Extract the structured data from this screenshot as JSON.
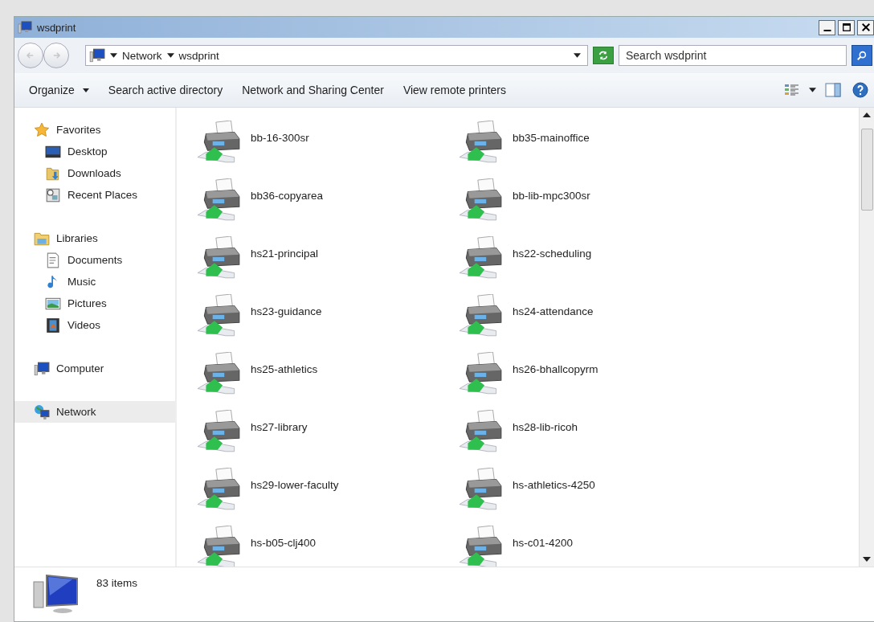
{
  "window": {
    "title": "wsdprint"
  },
  "address_bar": {
    "breadcrumbs": [
      "Network",
      "wsdprint"
    ]
  },
  "search": {
    "placeholder": "Search wsdprint"
  },
  "toolbar": [
    {
      "label": "Organize",
      "kind": "menu"
    },
    {
      "label": "Search active directory",
      "kind": "command"
    },
    {
      "label": "Network and Sharing Center",
      "kind": "command"
    },
    {
      "label": "View remote printers",
      "kind": "command"
    }
  ],
  "navigation": [
    {
      "label": "Favorites",
      "selected": false,
      "children": [
        {
          "label": "Desktop",
          "selected": false
        },
        {
          "label": "Downloads",
          "selected": false
        },
        {
          "label": "Recent Places",
          "selected": false
        }
      ]
    },
    {
      "label": "Libraries",
      "selected": false,
      "children": [
        {
          "label": "Documents",
          "selected": false
        },
        {
          "label": "Music",
          "selected": false
        },
        {
          "label": "Pictures",
          "selected": false
        },
        {
          "label": "Videos",
          "selected": false
        }
      ]
    },
    {
      "label": "Computer",
      "selected": false
    },
    {
      "label": "Network",
      "selected": true
    }
  ],
  "items": [
    {
      "name": "bb-16-300sr"
    },
    {
      "name": "bb35-mainoffice"
    },
    {
      "name": "bb36-copyarea"
    },
    {
      "name": "bb-lib-mpc300sr"
    },
    {
      "name": "hs21-principal"
    },
    {
      "name": "hs22-scheduling"
    },
    {
      "name": "hs23-guidance"
    },
    {
      "name": "hs24-attendance"
    },
    {
      "name": "hs25-athletics"
    },
    {
      "name": "hs26-bhallcopyrm"
    },
    {
      "name": "hs27-library"
    },
    {
      "name": "hs28-lib-ricoh"
    },
    {
      "name": "hs29-lower-faculty"
    },
    {
      "name": "hs-athletics-4250"
    },
    {
      "name": "hs-b05-clj400"
    },
    {
      "name": "hs-c01-4200"
    }
  ],
  "status": {
    "count": "83 items"
  }
}
